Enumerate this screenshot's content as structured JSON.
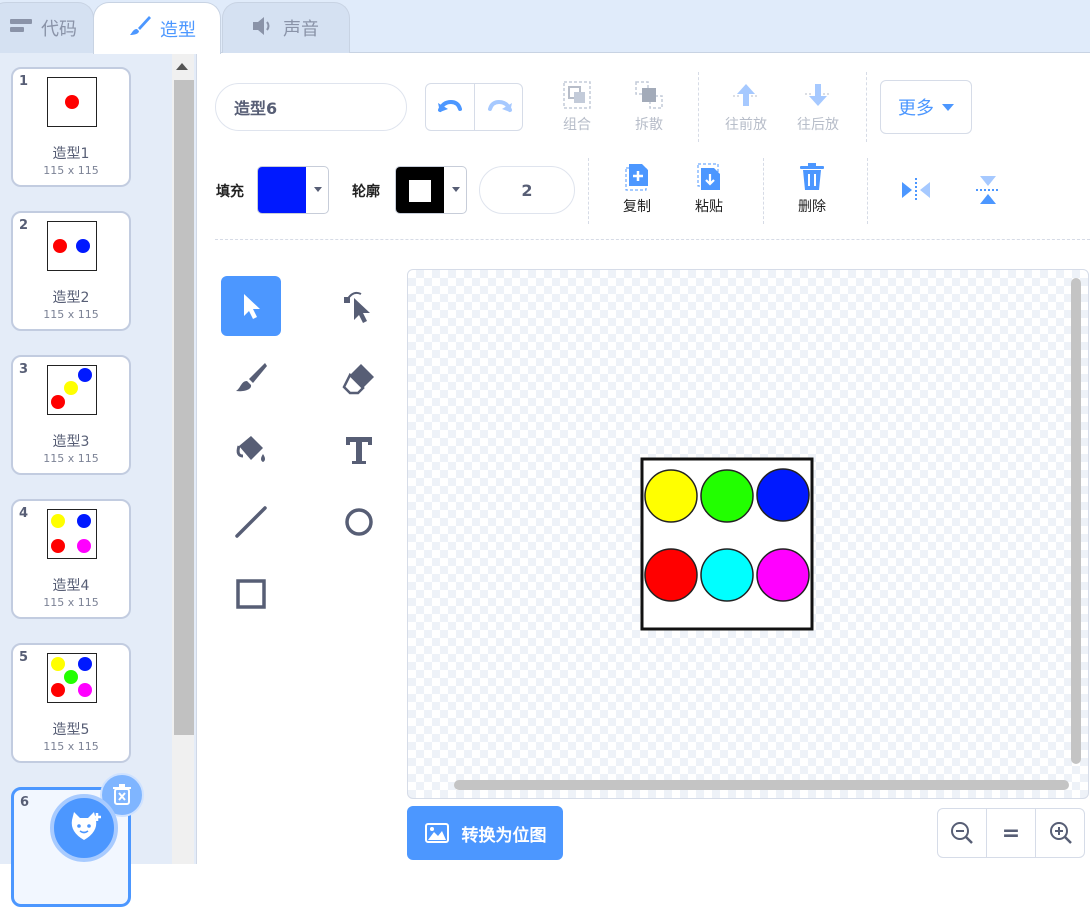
{
  "tabs": [
    {
      "label": "代码",
      "icon": "code-icon"
    },
    {
      "label": "造型",
      "icon": "brush-icon",
      "active": true
    },
    {
      "label": "声音",
      "icon": "speaker-icon"
    }
  ],
  "costumes": [
    {
      "num": "1",
      "name": "造型1",
      "size": "115 x 115"
    },
    {
      "num": "2",
      "name": "造型2",
      "size": "115 x 115"
    },
    {
      "num": "3",
      "name": "造型3",
      "size": "115 x 115"
    },
    {
      "num": "4",
      "name": "造型4",
      "size": "115 x 115"
    },
    {
      "num": "5",
      "name": "造型5",
      "size": "115 x 115"
    },
    {
      "num": "6"
    }
  ],
  "toolbar": {
    "costume_name": "造型6",
    "group": "组合",
    "ungroup": "拆散",
    "forward": "往前放",
    "backward": "往后放",
    "more": "更多",
    "fill_label": "填充",
    "fill_color": "#0019ff",
    "outline_label": "轮廓",
    "outline_width": "2",
    "copy": "复制",
    "paste": "粘贴",
    "delete": "删除"
  },
  "convert_button": "转换为位图",
  "zoom": {
    "out": "zoom-out-icon",
    "reset": "=",
    "in": "zoom-in-icon"
  },
  "colors": {
    "accent": "#4c97ff",
    "yellow": "#ffff00",
    "green": "#22ff00",
    "blue": "#0019ff",
    "red": "#ff0000",
    "cyan": "#00ffff",
    "magenta": "#ff00ff"
  }
}
